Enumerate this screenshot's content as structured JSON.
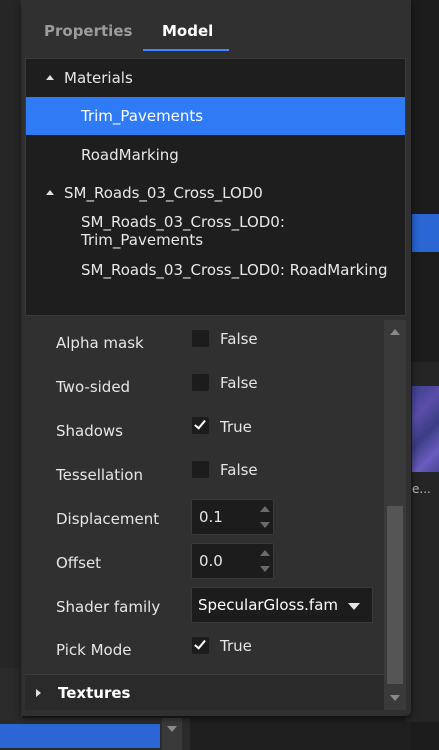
{
  "tabs": [
    {
      "label": "Properties",
      "active": false
    },
    {
      "label": "Model",
      "active": true
    }
  ],
  "tree": {
    "materials_label": "Materials",
    "material_items": [
      "Trim_Pavements",
      "RoadMarking"
    ],
    "selected_item": "Trim_Pavements",
    "mesh_label": "SM_Roads_03_Cross_LOD0",
    "mesh_items": [
      "SM_Roads_03_Cross_LOD0: Trim_Pavements",
      "SM_Roads_03_Cross_LOD0: RoadMarking"
    ]
  },
  "properties": {
    "alpha_mask": {
      "label": "Alpha mask",
      "value": "False",
      "checked": false
    },
    "two_sided": {
      "label": "Two-sided",
      "value": "False",
      "checked": false
    },
    "shadows": {
      "label": "Shadows",
      "value": "True",
      "checked": true
    },
    "tessellation": {
      "label": "Tessellation",
      "value": "False",
      "checked": false
    },
    "displacement": {
      "label": "Displacement",
      "value": "0.1"
    },
    "offset": {
      "label": "Offset",
      "value": "0.0"
    },
    "shader_family": {
      "label": "Shader family",
      "value": "SpecularGloss.fam"
    },
    "pick_mode": {
      "label": "Pick Mode",
      "value": "True",
      "checked": true
    }
  },
  "textures_section": {
    "label": "Textures",
    "expanded": false
  },
  "background": {
    "thumbnail_caption": "e..."
  },
  "colors": {
    "accent": "#2f7bf5",
    "panel": "#303030",
    "field": "#1c1c1c"
  }
}
